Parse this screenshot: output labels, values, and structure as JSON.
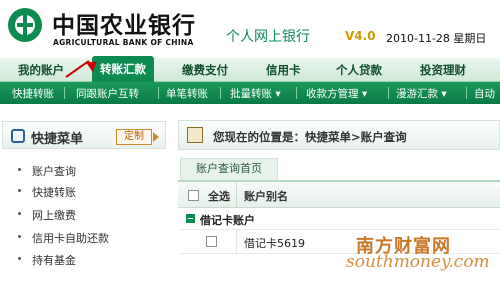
{
  "header": {
    "bank_name_cn": "中国农业银行",
    "bank_name_en": "AGRICULTURAL BANK OF CHINA",
    "ebank_title": "个人网上银行",
    "ebank_version": "V4.0",
    "date_text": "2010-11-28 星期日"
  },
  "main_nav": {
    "tabs": [
      {
        "label": "我的账户"
      },
      {
        "label": "转账汇款",
        "active": true
      },
      {
        "label": "缴费支付"
      },
      {
        "label": "信用卡"
      },
      {
        "label": "个人贷款"
      },
      {
        "label": "投资理财"
      }
    ]
  },
  "sub_nav": {
    "items": [
      {
        "label": "快捷转账"
      },
      {
        "label": "同跟账户互转"
      },
      {
        "label": "单笔转账"
      },
      {
        "label": "批量转账 ▾"
      },
      {
        "label": "收款方管理 ▾"
      },
      {
        "label": "漫游汇款 ▾"
      },
      {
        "label": "自动"
      }
    ]
  },
  "quick_menu": {
    "title": "快捷菜单",
    "customize_label": "定制",
    "items": [
      {
        "label": "账户查询"
      },
      {
        "label": "快捷转账"
      },
      {
        "label": "网上缴费"
      },
      {
        "label": "信用卡自助还款"
      },
      {
        "label": "持有基金"
      }
    ]
  },
  "location": {
    "text": "您现在的位置是：快捷菜单>账户查询"
  },
  "content": {
    "tab_label": "账户查询首页",
    "table": {
      "select_all_label": "全选",
      "alias_header": "账户别名",
      "group_label": "借记卡账户",
      "rows": [
        {
          "alias": "借记卡5619"
        }
      ]
    }
  },
  "watermark": {
    "cn": "南方财富网",
    "en": "southmoney.com"
  },
  "colors": {
    "brand_green": "#0d8c52",
    "submenu_green": "#0b7a45",
    "version_gold": "#d49a00",
    "watermark_orange": "#c46a12"
  }
}
